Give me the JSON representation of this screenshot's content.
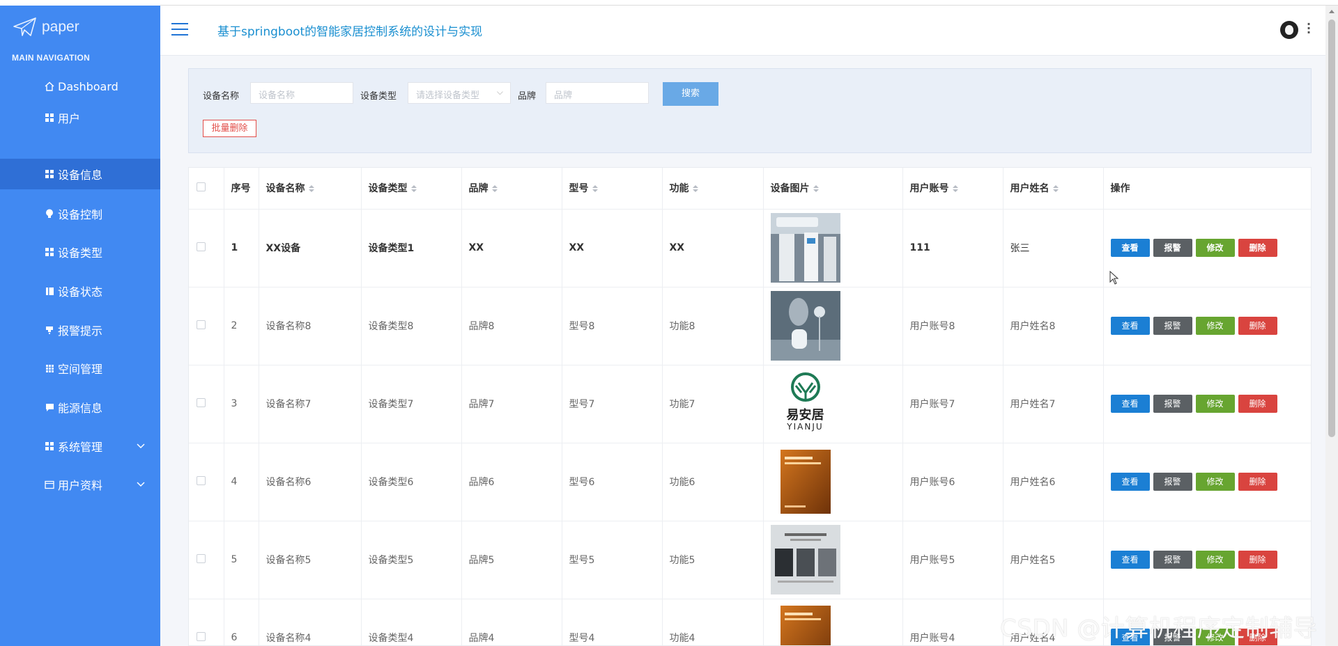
{
  "sidebar": {
    "logo_text": "paper",
    "heading": "MAIN NAVIGATION",
    "items": [
      {
        "label": "Dashboard",
        "icon": "home-icon"
      },
      {
        "label": "用户",
        "icon": "grid-icon"
      },
      {
        "label": "设备信息",
        "icon": "grid-icon",
        "active": true
      },
      {
        "label": "设备控制",
        "icon": "bulb-icon"
      },
      {
        "label": "设备类型",
        "icon": "grid-icon"
      },
      {
        "label": "设备状态",
        "icon": "book-icon"
      },
      {
        "label": "报警提示",
        "icon": "bell-icon"
      },
      {
        "label": "空间管理",
        "icon": "grid-icon"
      },
      {
        "label": "能源信息",
        "icon": "comment-icon"
      },
      {
        "label": "系统管理",
        "icon": "grid-icon",
        "expandable": true
      },
      {
        "label": "用户资料",
        "icon": "profile-icon",
        "expandable": true
      }
    ],
    "colors": {
      "background": "#4189f2",
      "active": "#2f6fd6"
    }
  },
  "header": {
    "title": "基于springboot的智能家居控制系统的设计与实现"
  },
  "search": {
    "name_label": "设备名称",
    "name_placeholder": "设备名称",
    "type_label": "设备类型",
    "type_placeholder": "请选择设备类型",
    "brand_label": "品牌",
    "brand_placeholder": "品牌",
    "search_button": "搜索",
    "batch_delete_button": "批量删除"
  },
  "table": {
    "columns": [
      "序号",
      "设备名称",
      "设备类型",
      "品牌",
      "型号",
      "功能",
      "设备图片",
      "用户账号",
      "用户姓名",
      "操作"
    ],
    "sortable": [
      false,
      true,
      true,
      true,
      true,
      true,
      true,
      true,
      true,
      false
    ],
    "actions": {
      "view": "查看",
      "alarm": "报警",
      "edit": "修改",
      "delete": "删除"
    },
    "rows": [
      {
        "no": "1",
        "name": "XX设备",
        "type": "设备类型1",
        "brand": "XX",
        "model": "XX",
        "func": "XX",
        "image": "air-conditioner-photo",
        "account": "111",
        "username": "张三"
      },
      {
        "no": "2",
        "name": "设备名称8",
        "type": "设备类型8",
        "brand": "品牌8",
        "model": "型号8",
        "func": "功能8",
        "image": "humidifier-photo",
        "account": "用户账号8",
        "username": "用户姓名8"
      },
      {
        "no": "3",
        "name": "设备名称7",
        "type": "设备类型7",
        "brand": "品牌7",
        "model": "型号7",
        "func": "功能7",
        "image": "yianju-logo",
        "account": "用户账号7",
        "username": "用户姓名7"
      },
      {
        "no": "4",
        "name": "设备名称6",
        "type": "设备类型6",
        "brand": "品牌6",
        "model": "型号6",
        "func": "功能6",
        "image": "book-cover-orange",
        "account": "用户账号6",
        "username": "用户姓名6"
      },
      {
        "no": "5",
        "name": "设备名称5",
        "type": "设备类型5",
        "brand": "品牌5",
        "model": "型号5",
        "func": "功能5",
        "image": "book-cover-grey",
        "account": "用户账号5",
        "username": "用户姓名5"
      },
      {
        "no": "6",
        "name": "设备名称4",
        "type": "设备类型4",
        "brand": "品牌4",
        "model": "型号4",
        "func": "功能4",
        "image": "book-cover-orange",
        "account": "用户账号4",
        "username": "用户姓名4"
      }
    ]
  },
  "image_text": {
    "yianju_cn": "易安居",
    "yianju_en": "YIANJU"
  },
  "watermark": "CSDN @计算机程序定制辅导"
}
